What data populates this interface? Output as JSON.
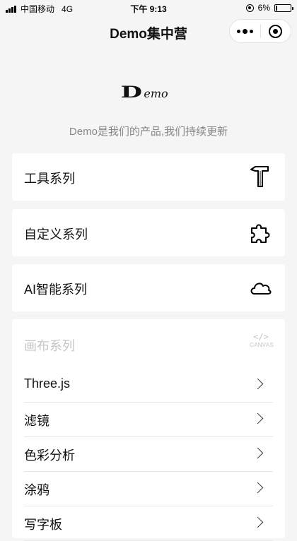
{
  "status_bar": {
    "carrier": "中国移动",
    "network": "4G",
    "time": "下午 9:13",
    "battery": "6%",
    "battery_level": 0.06
  },
  "nav": {
    "title": "Demo集中营"
  },
  "logo": {
    "initial": "D",
    "rest": "emo"
  },
  "subtitle": "Demo是我们的产品,我们持续更新",
  "cards": [
    {
      "label": "工具系列",
      "icon": "hammer-icon"
    },
    {
      "label": "自定义系列",
      "icon": "puzzle-icon"
    },
    {
      "label": "AI智能系列",
      "icon": "cloud-icon"
    }
  ],
  "canvas_section": {
    "title": "画布系列",
    "icon_code": "</>",
    "icon_word": "CANVAS",
    "items": [
      {
        "label": "Three.js"
      },
      {
        "label": "滤镜"
      },
      {
        "label": "色彩分析"
      },
      {
        "label": "涂鸦"
      },
      {
        "label": "写字板"
      }
    ]
  }
}
